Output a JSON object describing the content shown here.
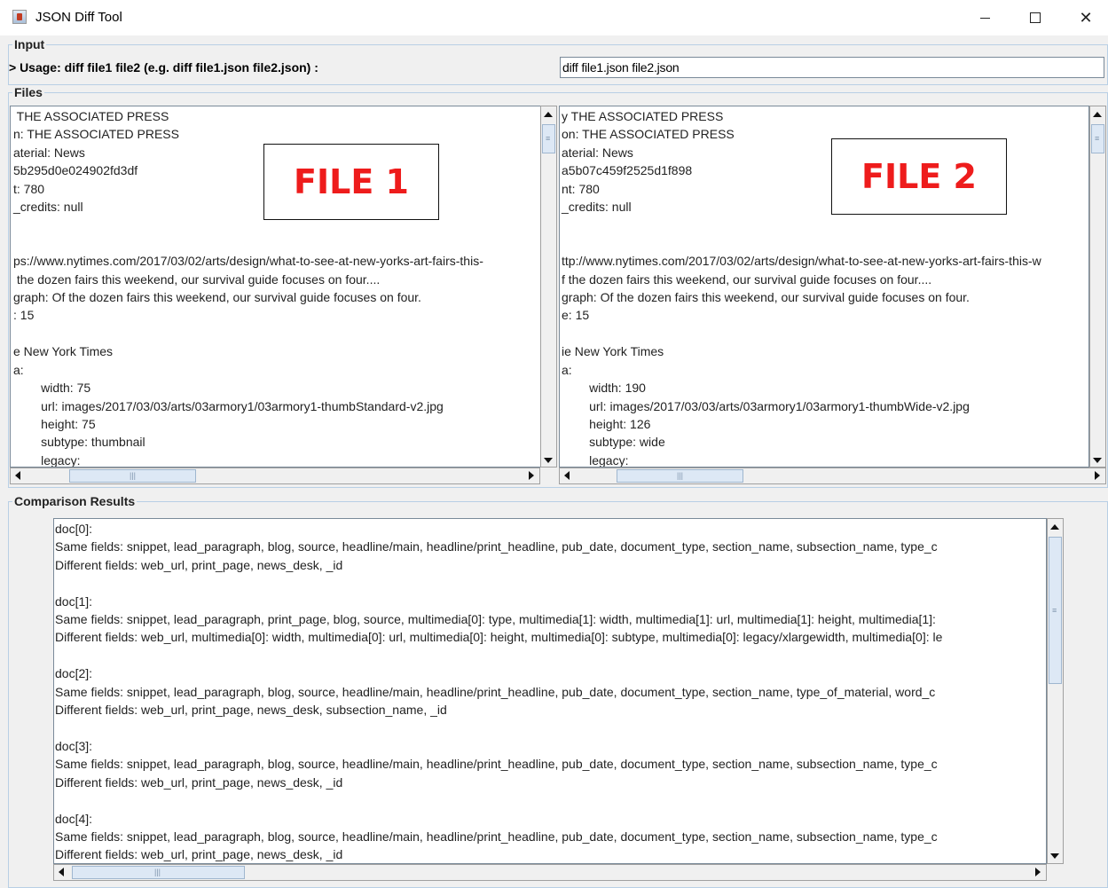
{
  "window": {
    "title": "JSON Diff Tool"
  },
  "input": {
    "group_title": "Input",
    "usage_label": "> Usage: diff file1 file2 (e.g. diff file1.json file2.json) :",
    "command_value": "diff file1.json file2.json"
  },
  "files": {
    "group_title": "Files",
    "file1": {
      "label": "FILE 1",
      "lines": [
        " THE ASSOCIATED PRESS",
        "n: THE ASSOCIATED PRESS",
        "aterial: News",
        "5b295d0e024902fd3df",
        "t: 780",
        "_credits: null",
        "",
        "",
        "ps://www.nytimes.com/2017/03/02/arts/design/what-to-see-at-new-yorks-art-fairs-this-",
        " the dozen fairs this weekend, our survival guide focuses on four....",
        "graph: Of the dozen fairs this weekend, our survival guide focuses on four.",
        ": 15",
        "",
        "e New York Times",
        "a:",
        "        width: 75",
        "        url: images/2017/03/03/arts/03armory1/03armory1-thumbStandard-v2.jpg",
        "        height: 75",
        "        subtype: thumbnail",
        "        legacy:"
      ]
    },
    "file2": {
      "label": "FILE 2",
      "lines": [
        "y THE ASSOCIATED PRESS",
        "on: THE ASSOCIATED PRESS",
        "aterial: News",
        "a5b07c459f2525d1f898",
        "nt: 780",
        "_credits: null",
        "",
        "",
        "ttp://www.nytimes.com/2017/03/02/arts/design/what-to-see-at-new-yorks-art-fairs-this-w",
        "f the dozen fairs this weekend, our survival guide focuses on four....",
        "graph: Of the dozen fairs this weekend, our survival guide focuses on four.",
        "e: 15",
        "",
        "ie New York Times",
        "a:",
        "        width: 190",
        "        url: images/2017/03/03/arts/03armory1/03armory1-thumbWide-v2.jpg",
        "        height: 126",
        "        subtype: wide",
        "        legacy:"
      ]
    }
  },
  "results": {
    "group_title": "Comparison Results",
    "lines": [
      "doc[0]:",
      "Same fields: snippet, lead_paragraph, blog, source, headline/main, headline/print_headline, pub_date, document_type, section_name, subsection_name, type_c",
      "Different fields: web_url, print_page, news_desk, _id",
      "",
      "doc[1]:",
      "Same fields: snippet, lead_paragraph, print_page, blog, source, multimedia[0]: type, multimedia[1]: width, multimedia[1]: url, multimedia[1]: height, multimedia[1]:",
      "Different fields: web_url, multimedia[0]: width, multimedia[0]: url, multimedia[0]: height, multimedia[0]: subtype, multimedia[0]: legacy/xlargewidth, multimedia[0]: le",
      "",
      "doc[2]:",
      "Same fields: snippet, lead_paragraph, blog, source, headline/main, headline/print_headline, pub_date, document_type, section_name, type_of_material, word_c",
      "Different fields: web_url, print_page, news_desk, subsection_name, _id",
      "",
      "doc[3]:",
      "Same fields: snippet, lead_paragraph, blog, source, headline/main, headline/print_headline, pub_date, document_type, section_name, subsection_name, type_c",
      "Different fields: web_url, print_page, news_desk, _id",
      "",
      "doc[4]:",
      "Same fields: snippet, lead_paragraph, blog, source, headline/main, headline/print_headline, pub_date, document_type, section_name, subsection_name, type_c",
      "Different fields: web_url, print_page, news_desk, _id"
    ]
  },
  "icons": {
    "app": "java-cup-icon",
    "minimize": "minimize-icon",
    "maximize": "maximize-icon",
    "close": "close-icon"
  },
  "colors": {
    "file_label_red": "#ee1c1c",
    "group_border": "#b8cfe5",
    "scroll_thumb": "#dde8f5"
  }
}
